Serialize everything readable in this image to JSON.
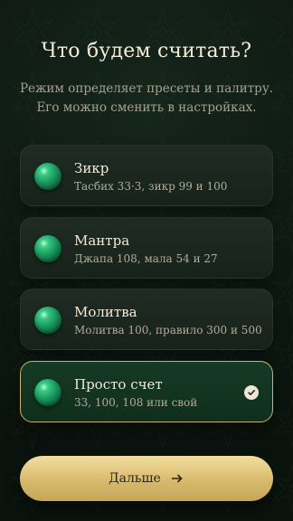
{
  "header": {
    "title": "Что будем считать?",
    "subtitle": "Режим определяет пресеты и палитру. Его можно сменить в настройках."
  },
  "options": [
    {
      "title": "Зикр",
      "desc": "Тасбих 33·3, зикр 99 и 100",
      "selected": false
    },
    {
      "title": "Мантра",
      "desc": "Джапа 108, мала 54 и 27",
      "selected": false
    },
    {
      "title": "Молитва",
      "desc": "Молитва 100, правило 300 и 500",
      "selected": false
    },
    {
      "title": "Просто счет",
      "desc": "33, 100, 108 или свой",
      "selected": true
    }
  ],
  "cta": {
    "label": "Дальше"
  },
  "icons": {
    "option_orb": "green-bead-icon",
    "selected_check": "check-circle-icon",
    "cta_arrow": "arrow-right-icon"
  },
  "colors": {
    "background": "#0f1a13",
    "card": "#1f2b23",
    "selected_border": "#c9b06b",
    "cta_gold": "#d8ba6c"
  }
}
